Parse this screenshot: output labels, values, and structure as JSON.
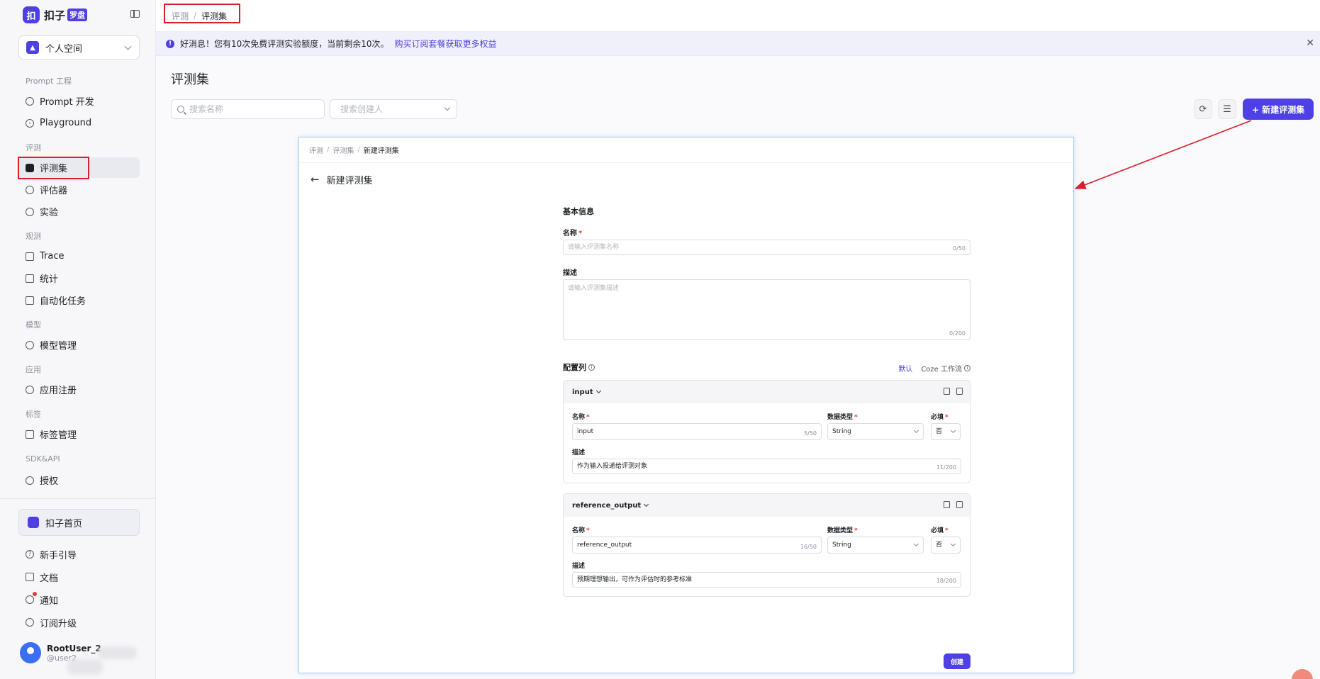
{
  "app": {
    "logo_mark": "扣",
    "logo_text": "扣子",
    "logo_badge": "罗盘",
    "space": "个人空间"
  },
  "sidebar": {
    "groups": [
      {
        "label": "Prompt 工程",
        "items": [
          {
            "label": "Prompt 开发",
            "icon": "chat-icon"
          },
          {
            "label": "Playground",
            "icon": "play-icon"
          }
        ]
      },
      {
        "label": "评测",
        "items": [
          {
            "label": "评测集",
            "icon": "dataset-icon",
            "active": true
          },
          {
            "label": "评估器",
            "icon": "evaluator-icon"
          },
          {
            "label": "实验",
            "icon": "experiment-icon"
          }
        ]
      },
      {
        "label": "观测",
        "items": [
          {
            "label": "Trace",
            "icon": "trace-icon"
          },
          {
            "label": "统计",
            "icon": "stats-icon"
          },
          {
            "label": "自动化任务",
            "icon": "task-icon"
          }
        ]
      },
      {
        "label": "模型",
        "items": [
          {
            "label": "模型管理",
            "icon": "model-icon"
          }
        ]
      },
      {
        "label": "应用",
        "items": [
          {
            "label": "应用注册",
            "icon": "app-icon"
          }
        ]
      },
      {
        "label": "标签",
        "items": [
          {
            "label": "标签管理",
            "icon": "tag-icon"
          }
        ]
      },
      {
        "label": "SDK&API",
        "items": [
          {
            "label": "授权",
            "icon": "auth-icon"
          }
        ]
      }
    ],
    "home": "扣子首页",
    "bottom_items": [
      {
        "label": "新手引导",
        "icon": "guide-icon"
      },
      {
        "label": "文档",
        "icon": "doc-icon"
      },
      {
        "label": "通知",
        "icon": "bell-icon"
      },
      {
        "label": "订阅升级",
        "icon": "upgrade-icon"
      }
    ],
    "user": {
      "name": "RootUser_2",
      "handle": "@user2"
    }
  },
  "topbar": {
    "crumbs": [
      "评测",
      "评测集"
    ]
  },
  "notice": {
    "text": "好消息！您有10次免费评测实验额度，当前剩余10次。",
    "link": "购买订阅套餐获取更多权益"
  },
  "page": {
    "title": "评测集",
    "search_placeholder": "搜索名称",
    "creator_placeholder": "搜索创建人",
    "new_button": "+ 新建评测集"
  },
  "modal": {
    "crumbs": [
      "评测",
      "评测集",
      "新建评测集"
    ],
    "title": "新建评测集",
    "basic_info": "基本信息",
    "name_label": "名称",
    "name_placeholder": "请输入评测集名称",
    "name_counter": "0/50",
    "desc_label": "描述",
    "desc_placeholder": "请输入评测集描述",
    "desc_counter": "0/200",
    "config_label": "配置列",
    "config_default": "默认",
    "config_coze": "Coze 工作流",
    "col_name_label": "名称",
    "col_type_label": "数据类型",
    "col_required_label": "必填",
    "col_desc_label": "描述",
    "columns": [
      {
        "title": "input",
        "name": "input",
        "name_counter": "5/50",
        "type": "String",
        "required": "否",
        "desc": "作为输入投递给评测对象",
        "desc_counter": "11/200"
      },
      {
        "title": "reference_output",
        "name": "reference_output",
        "name_counter": "16/50",
        "type": "String",
        "required": "否",
        "desc": "预期理想输出，可作为评估时的参考标准",
        "desc_counter": "18/200"
      }
    ],
    "create_button": "创建"
  },
  "colors": {
    "accent": "#4e40e5",
    "annotation_red": "#d81e2b",
    "modal_border": "#a9cdf2"
  }
}
